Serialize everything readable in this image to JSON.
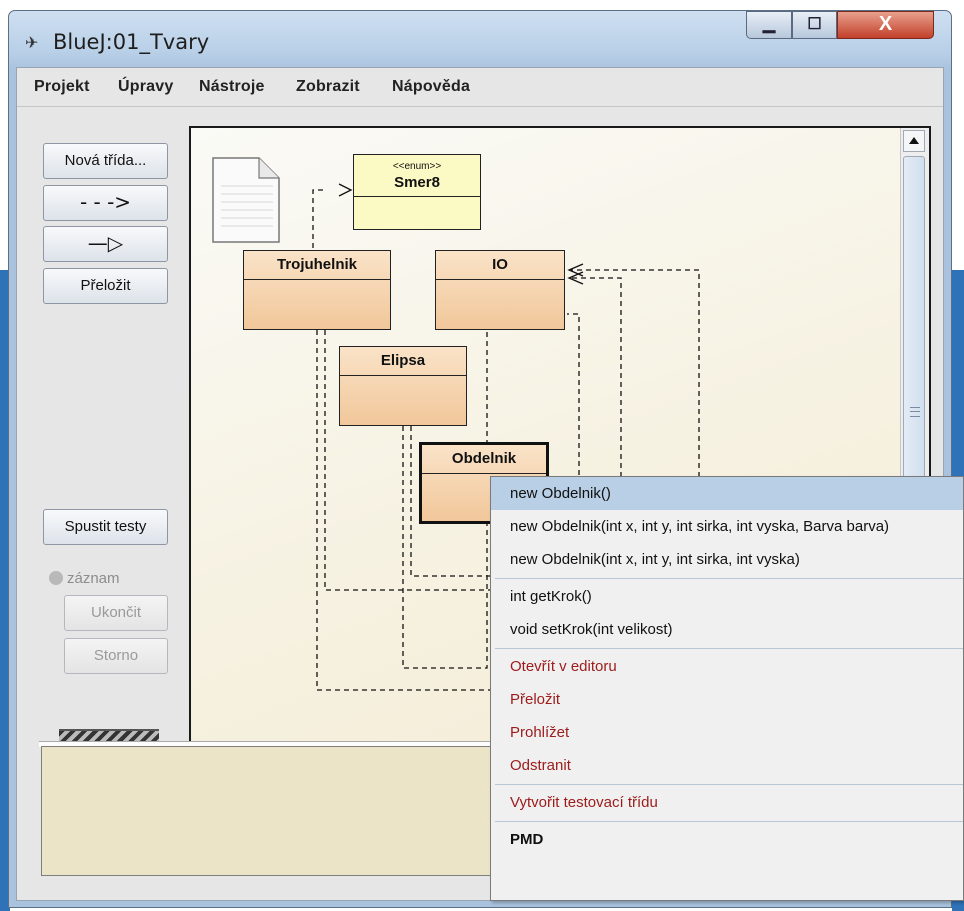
{
  "window": {
    "title": "BlueJ:01_Tvary"
  },
  "menubar": [
    "Projekt",
    "Úpravy",
    "Nástroje",
    "Zobrazit",
    "Nápověda"
  ],
  "toolbar": {
    "new_class": "Nová třída...",
    "compile": "Přeložit",
    "run_tests": "Spustit testy",
    "record": "záznam",
    "end": "Ukončit",
    "cancel": "Storno"
  },
  "classes": {
    "smer8_stereotype": "<<enum>>",
    "smer8": "Smer8",
    "trojuhelnik": "Trojuhelnik",
    "io": "IO",
    "elipsa": "Elipsa",
    "obdelnik": "Obdelnik"
  },
  "context_menu": {
    "constructors": [
      "new Obdelnik()",
      "new Obdelnik(int x, int y, int sirka, int vyska, Barva barva)",
      "new Obdelnik(int x, int y, int sirka, int vyska)"
    ],
    "methods": [
      "int getKrok()",
      "void setKrok(int velikost)"
    ],
    "actions": [
      "Otevřít v editoru",
      "Přeložit",
      "Prohlížet",
      "Odstranit"
    ],
    "test": "Vytvořit testovací třídu",
    "pmd": "PMD"
  }
}
